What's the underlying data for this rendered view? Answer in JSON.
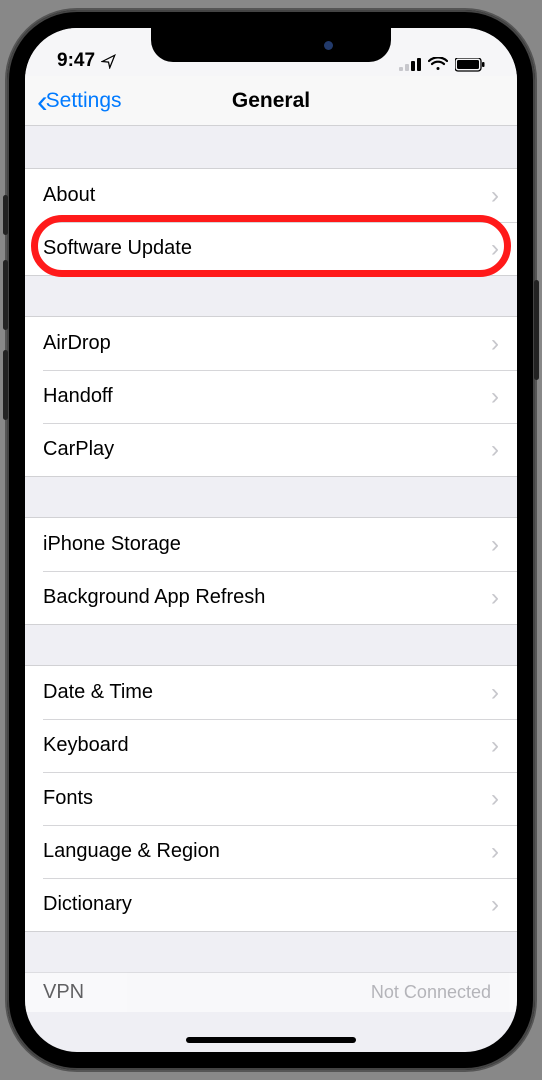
{
  "status": {
    "time": "9:47",
    "location_icon": "location-arrow"
  },
  "nav": {
    "back_label": "Settings",
    "title": "General"
  },
  "groups": [
    {
      "id": "g1",
      "rows": [
        {
          "id": "about",
          "label": "About"
        },
        {
          "id": "software-update",
          "label": "Software Update",
          "highlighted": true
        }
      ]
    },
    {
      "id": "g2",
      "rows": [
        {
          "id": "airdrop",
          "label": "AirDrop"
        },
        {
          "id": "handoff",
          "label": "Handoff"
        },
        {
          "id": "carplay",
          "label": "CarPlay"
        }
      ]
    },
    {
      "id": "g3",
      "rows": [
        {
          "id": "iphone-storage",
          "label": "iPhone Storage"
        },
        {
          "id": "background-app-refresh",
          "label": "Background App Refresh"
        }
      ]
    },
    {
      "id": "g4",
      "rows": [
        {
          "id": "date-time",
          "label": "Date & Time"
        },
        {
          "id": "keyboard",
          "label": "Keyboard"
        },
        {
          "id": "fonts",
          "label": "Fonts"
        },
        {
          "id": "language-region",
          "label": "Language & Region"
        },
        {
          "id": "dictionary",
          "label": "Dictionary"
        }
      ]
    }
  ],
  "partial_row": {
    "label": "VPN",
    "detail": "Not Connected"
  }
}
